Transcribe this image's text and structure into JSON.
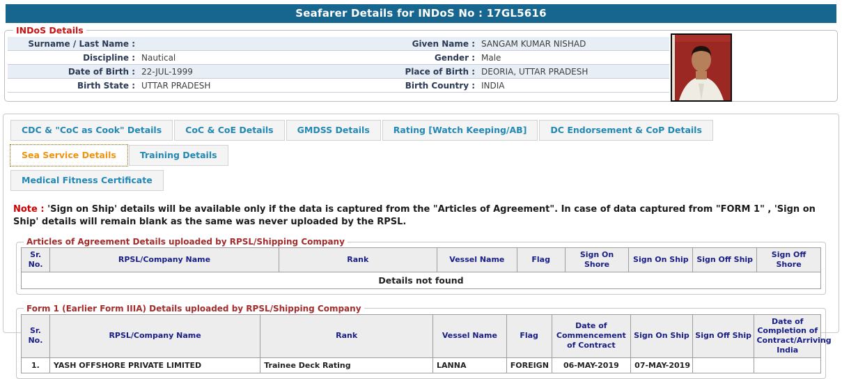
{
  "header": {
    "title": "Seafarer Details for INDoS No : 17GL5616"
  },
  "colors": {
    "titlebar_bg": "#16668f",
    "tab_link": "#2288b5",
    "tab_active": "#f0930f",
    "legend_red": "#cc1111",
    "table_legend_maroon": "#a32c2c",
    "table_header_navy": "#181d86",
    "error_red": "#cc0000",
    "stripe_row": "#e8eef6",
    "photo_background": "#9b2823"
  },
  "indos": {
    "legend": "INDoS Details",
    "rows": [
      {
        "left_label": "Surname / Last Name :",
        "left_value": "",
        "right_label": "Given Name :",
        "right_value": "SANGAM KUMAR NISHAD"
      },
      {
        "left_label": "Discipline :",
        "left_value": "Nautical",
        "right_label": "Gender :",
        "right_value": "Male"
      },
      {
        "left_label": "Date of Birth :",
        "left_value": "22-JUL-1999",
        "right_label": "Place of Birth :",
        "right_value": "DEORIA, UTTAR PRADESH"
      },
      {
        "left_label": "Birth State :",
        "left_value": "UTTAR PRADESH",
        "right_label": "Birth Country :",
        "right_value": "INDIA"
      }
    ],
    "photo": {
      "description": "seafarer-passport-photo"
    }
  },
  "tabs": {
    "items": [
      {
        "label": "CDC & \"CoC as Cook\" Details",
        "active": false
      },
      {
        "label": "CoC & CoE Details",
        "active": false
      },
      {
        "label": "GMDSS Details",
        "active": false
      },
      {
        "label": "Rating [Watch Keeping/AB]",
        "active": false
      },
      {
        "label": "DC Endorsement & CoP Details",
        "active": false
      },
      {
        "label": "Sea Service Details",
        "active": true
      },
      {
        "label": "Training Details",
        "active": false
      },
      {
        "label": "Medical Fitness Certificate",
        "active": false
      }
    ]
  },
  "note": {
    "prefix": "Note :",
    "text": " 'Sign on Ship' details will be available only if the data is captured from the \"Articles of Agreement\". In case of data captured from \"FORM 1\" , 'Sign on Ship' details will remain blank as the same was never uploaded by the RPSL."
  },
  "articles_table": {
    "legend": "Articles of Agreement Details uploaded by RPSL/Shipping Company",
    "columns": [
      "Sr. No.",
      "RPSL/Company Name",
      "Rank",
      "Vessel Name",
      "Flag",
      "Sign On Shore",
      "Sign On Ship",
      "Sign Off Ship",
      "Sign Off Shore"
    ],
    "empty_message": "Details not found"
  },
  "form1_table": {
    "legend": "Form 1 (Earlier Form IIIA) Details uploaded by RPSL/Shipping Company",
    "columns": [
      "Sr. No.",
      "RPSL/Company Name",
      "Rank",
      "Vessel Name",
      "Flag",
      "Date of Commencement of Contract",
      "Sign On Ship",
      "Sign Off Ship",
      "Date of Completion of Contract/Arriving India"
    ],
    "rows": [
      {
        "cells": [
          "1.",
          "YASH OFFSHORE PRIVATE LIMITED",
          "Trainee Deck Rating",
          "LANNA",
          "FOREIGN",
          "06-MAY-2019",
          "07-MAY-2019",
          "",
          ""
        ]
      }
    ]
  }
}
